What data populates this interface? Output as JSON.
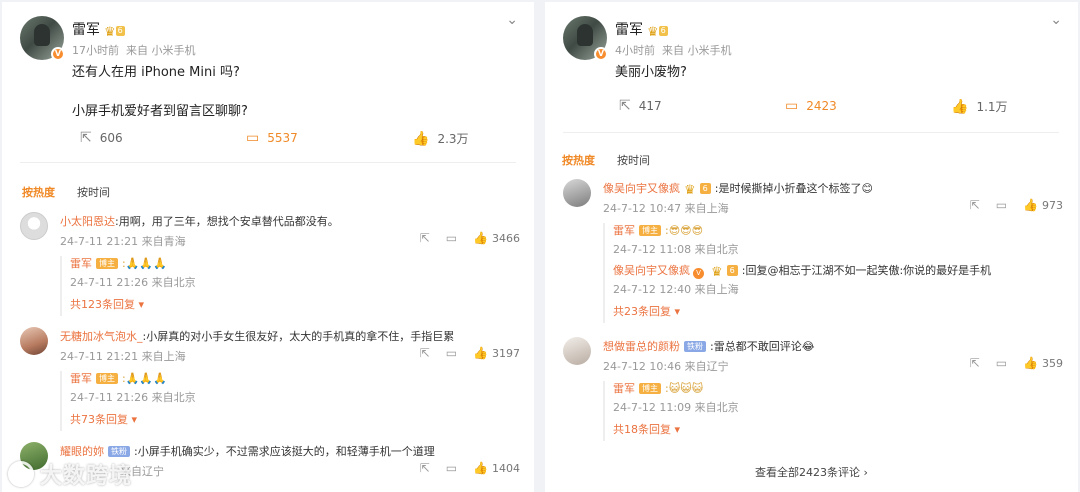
{
  "left": {
    "post": {
      "author": "雷军",
      "crown_icon": "crown-icon",
      "time": "17小时前",
      "source": "来自 小米手机",
      "lines": [
        "还有人在用 iPhone Mini 吗?",
        "小屏手机爱好者到留言区聊聊?"
      ],
      "reposts": "606",
      "comments": "5537",
      "likes": "2.3万"
    },
    "sort": {
      "hot": "按热度",
      "time": "按时间"
    },
    "comments": [
      {
        "user": "小太阳恩达",
        "text": ":用啊，用了三年，想找个安卓替代品都没有。",
        "time": "24-7-11 21:21 来自青海",
        "likes": "3466",
        "reply": {
          "user": "雷军",
          "tag": "博主",
          "text": ":🙏🙏🙏",
          "time": "24-7-11 21:26 来自北京"
        },
        "more": "共123条回复"
      },
      {
        "user": "无糖加冰气泡水_",
        "text": ":小屏真的对小手女生很友好，太大的手机真的拿不住，手指巨累",
        "time": "24-7-11 21:21 来自上海",
        "likes": "3197",
        "reply": {
          "user": "雷军",
          "tag": "博主",
          "text": ":🙏🙏🙏",
          "time": "24-7-11 21:26 来自北京"
        },
        "more": "共73条回复"
      },
      {
        "user": "耀眼的妳",
        "tag": "铁粉",
        "text": ":小屏手机确实少，不过需求应该挺大的，和轻薄手机一个道理",
        "time": "来自辽宁",
        "likes": "1404"
      }
    ]
  },
  "right": {
    "post": {
      "author": "雷军",
      "time": "4小时前",
      "source": "来自 小米手机",
      "line": "美丽小废物?",
      "reposts": "417",
      "comments": "2423",
      "likes": "1.1万"
    },
    "sort": {
      "hot": "按热度",
      "time": "按时间"
    },
    "comments": [
      {
        "user": "像吴向宇又像疯",
        "text": ":是时候撕掉小折叠这个标签了😊",
        "time": "24-7-12 10:47 来自上海",
        "likes": "973",
        "replies": [
          {
            "user": "雷军",
            "tag": "博主",
            "text": ":😎😎😎",
            "time": "24-7-12 11:08 来自北京"
          },
          {
            "user": "像吴向宇又像疯",
            "text": ":回复@相忘于江湖不如一起笑傲:你说的最好是手机",
            "time": "24-7-12 12:40 来自上海"
          }
        ],
        "more": "共23条回复"
      },
      {
        "user": "想做雷总的颜粉",
        "tag": "铁粉",
        "text": ":雷总都不敢回评论😂",
        "time": "24-7-12 10:46 来自辽宁",
        "likes": "359",
        "reply": {
          "user": "雷军",
          "tag": "博主",
          "text": ":😺😺😺",
          "time": "24-7-12 11:09 来自北京"
        },
        "more": "共18条回复"
      }
    ],
    "view_all": "查看全部2423条评论 ›"
  },
  "watermark": "大数跨境",
  "colors": {
    "accent": "#f08a28",
    "username": "#eb7340",
    "muted": "#999999"
  }
}
